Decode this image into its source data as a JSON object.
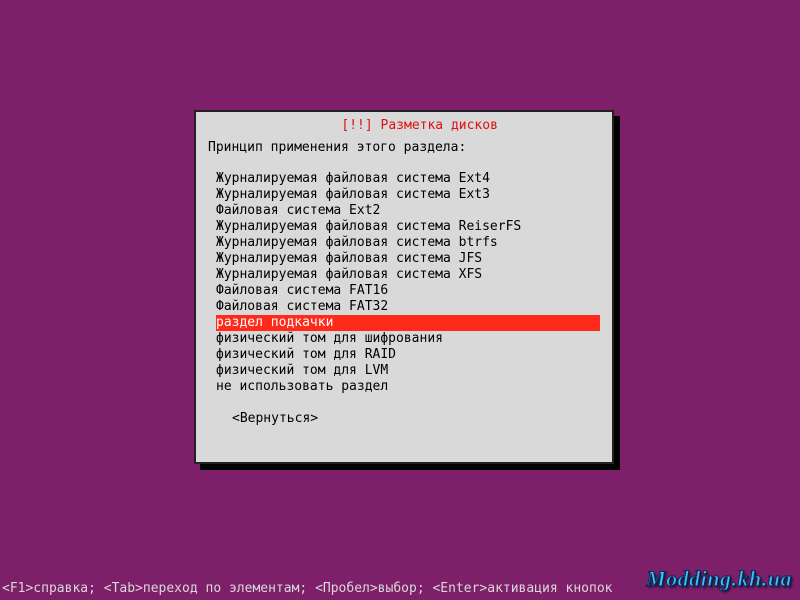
{
  "dialog": {
    "title_marker": "[!!]",
    "title_text": "Разметка дисков",
    "prompt": "Принцип применения этого раздела:",
    "options": [
      "Журналируемая файловая система Ext4",
      "Журналируемая файловая система Ext3",
      "Файловая система Ext2",
      "Журналируемая файловая система ReiserFS",
      "Журналируемая файловая система btrfs",
      "Журналируемая файловая система JFS",
      "Журналируемая файловая система XFS",
      "Файловая система FAT16",
      "Файловая система FAT32",
      "раздел подкачки",
      "физический том для шифрования",
      "физический том для RAID",
      "физический том для LVM",
      "не использовать раздел"
    ],
    "selected_index": 9,
    "back_label": "<Вернуться>"
  },
  "footer": {
    "help_text": "<F1>справка; <Tab>переход по элементам; <Пробел>выбор; <Enter>активация кнопок"
  },
  "watermark": "Modding.kh.ua",
  "colors": {
    "background": "#7e1f69",
    "dialog_bg": "#d9d9d9",
    "selection_bg": "#ff2a1a",
    "title_red": "#d11"
  }
}
